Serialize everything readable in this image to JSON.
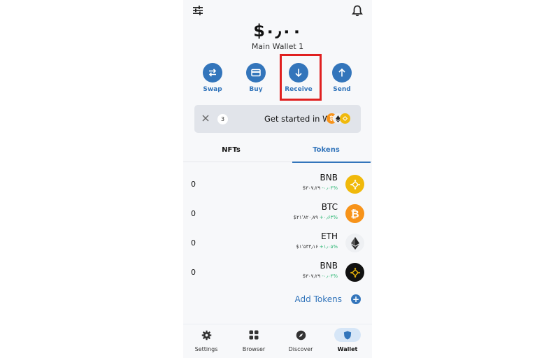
{
  "header": {
    "filter_icon": "sliders-icon",
    "bell_icon": "bell-icon"
  },
  "balance": {
    "amount": "$۰٫۰۰",
    "wallet_name": "Main Wallet 1"
  },
  "actions": {
    "swap": "Swap",
    "buy": "Buy",
    "receive": "Receive",
    "send": "Send"
  },
  "banner": {
    "count": "3",
    "text": "Get started in Web3"
  },
  "tabs": {
    "nfts": "NFTs",
    "tokens": "Tokens",
    "active": "Tokens"
  },
  "tokens": [
    {
      "amount": "0",
      "symbol": "BNB",
      "price": "$۳۰۷٫۲۹",
      "change": "-۰٫۰۴%",
      "color": "#F0B90B"
    },
    {
      "amount": "0",
      "symbol": "BTC",
      "price": "$۲۱٬۸۲۰٫۷۹",
      "change": "+۰٫۶۳%",
      "color": "#F7931A"
    },
    {
      "amount": "0",
      "symbol": "ETH",
      "price": "$۱٬۵۳۴٫۱۶",
      "change": "+۱٫۰۵%",
      "color": "#F2F3F5"
    },
    {
      "amount": "0",
      "symbol": "BNB",
      "price": "$۳۰۷٫۲۹",
      "change": "-۰٫۰۴%",
      "color": "#111111"
    }
  ],
  "add_tokens": "Add Tokens",
  "nav": {
    "settings": "Settings",
    "browser": "Browser",
    "discover": "Discover",
    "wallet": "Wallet",
    "active": "Wallet"
  },
  "colors": {
    "accent": "#3375bb",
    "highlight": "#e02020",
    "positive": "#2bb673"
  }
}
